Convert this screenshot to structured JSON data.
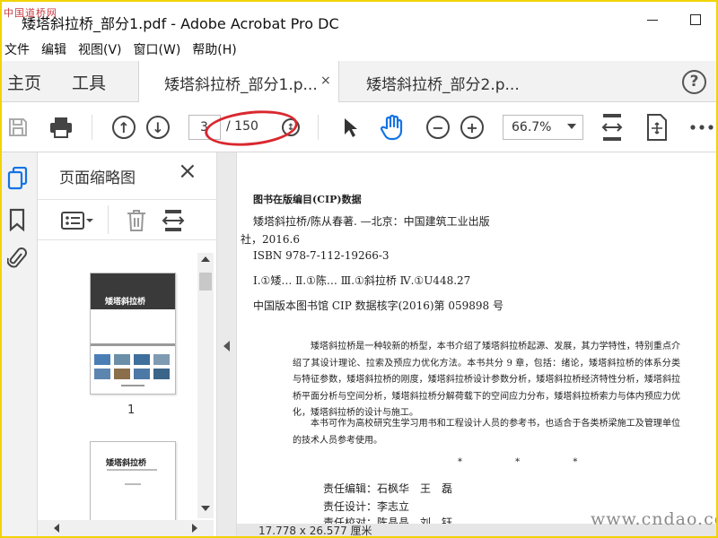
{
  "window": {
    "title": "矮塔斜拉桥_部分1.pdf - Adobe Acrobat Pro DC",
    "logo_text": "中国道桥网"
  },
  "menu": [
    "文件",
    "编辑",
    "视图(V)",
    "窗口(W)",
    "帮助(H)"
  ],
  "nav": {
    "home": "主页",
    "tools": "工具"
  },
  "tabs": [
    {
      "label": "矮塔斜拉桥_部分1.p...",
      "active": true,
      "close": "×"
    },
    {
      "label": "矮塔斜拉桥_部分2.p...",
      "active": false
    }
  ],
  "help": "?",
  "toolbar": {
    "current_page": "3",
    "total_pages": "/ 150",
    "zoom": "66.7%",
    "icons": [
      "save-icon",
      "print-icon",
      "prev-page-icon",
      "next-page-icon",
      "select-arrow-icon",
      "hand-icon",
      "zoom-out-icon",
      "zoom-in-icon",
      "fit-page-icon",
      "scroll-mode-icon",
      "more-icon"
    ]
  },
  "left_panel": {
    "title": "页面缩略图",
    "close": "×",
    "thumbnails": [
      {
        "label": "1",
        "cover_title": "矮塔斜拉桥"
      },
      {
        "label": "",
        "cover_title": "矮塔斜拉桥"
      }
    ]
  },
  "document": {
    "cip_title": "图书在版编目(CIP)数据",
    "cip_line1": "矮塔斜拉桥/陈从春著. —北京：中国建筑工业出版",
    "cip_line2": "社，2016.6",
    "isbn": "ISBN 978-7-112-19266-3",
    "classification": "Ⅰ.①矮…  Ⅱ.①陈…  Ⅲ.①斜拉桥  Ⅳ.①U448.27",
    "cip_check": "中国版本图书馆 CIP 数据核字(2016)第 059898 号",
    "abstract_p1": "矮塔斜拉桥是一种较新的桥型，本书介绍了矮塔斜拉桥起源、发展，其力学特性，特别重点介绍了其设计理论、拉索及预应力优化方法。本书共分 9 章，包括：绪论，矮塔斜拉桥的体系分类与特征参数，矮塔斜拉桥的刚度，矮塔斜拉桥设计参数分析，矮塔斜拉桥经济特性分析，矮塔斜拉桥平面分析与空间分析，矮塔斜拉桥分解荷载下的空间应力分布，矮塔斜拉桥索力与体内预应力优化，矮塔斜拉桥的设计与施工。",
    "abstract_p2": "本书可作为高校研究生学习用书和工程设计人员的参考书，也适合于各类桥梁施工及管理单位的技术人员参考使用。",
    "stars": "* * *",
    "editor": "责任编辑：石枫华　王　磊",
    "designer": "责任设计：李志立",
    "proofreader": "责任校对：陈晶晶　刘　钰",
    "page_size": "17.778 x 26.577 厘米"
  },
  "watermark": "www.cndao.com",
  "colors": {
    "highlight_ellipse": "#d9282f",
    "frame": "#f0d400",
    "accent_blue": "#1473e6"
  }
}
